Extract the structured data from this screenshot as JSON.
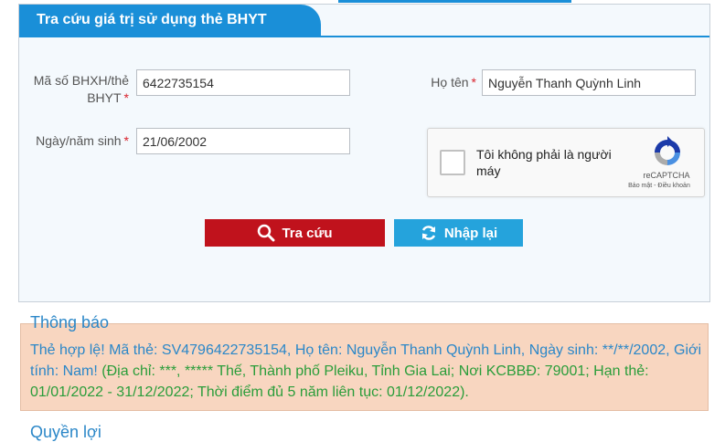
{
  "panel": {
    "title": "Tra cứu giá trị sử dụng thẻ BHYT"
  },
  "form": {
    "bhxh_label": "Mã số BHXH/thẻ BHYT",
    "bhxh_value": "6422735154",
    "name_label": "Họ tên",
    "name_value": "Nguyễn Thanh Quỳnh Linh",
    "dob_label": "Ngày/năm sinh",
    "dob_value": "21/06/2002",
    "required_mark": "*"
  },
  "captcha": {
    "label": "Tôi không phải là người máy",
    "brand": "reCAPTCHA",
    "links": "Bảo mật - Điều khoản"
  },
  "buttons": {
    "search": "Tra cứu",
    "reset": "Nhập lại"
  },
  "notice": {
    "title": "Thông báo",
    "line_blue": "Thẻ hợp lệ! Mã thẻ: SV4796422735154, Họ tên: Nguyễn Thanh Quỳnh Linh, Ngày sinh: **/**/2002, Giới tính: Nam! ",
    "line_green": "(Địa chỉ: ***, ***** Thế, Thành phố Pleiku, Tỉnh Gia Lai; Nơi KCBBĐ: 79001; Hạn thẻ: 01/01/2022 - 31/12/2022; Thời điểm đủ 5 năm liên tục: 01/12/2022)."
  },
  "section2": {
    "title": "Quyền lợi"
  },
  "colors": {
    "primary": "#1a8fd8",
    "danger": "#c0121c",
    "info": "#25a3dc",
    "notice_bg": "#f8d6c0"
  },
  "icons": {
    "search": "search-icon",
    "reset": "refresh-icon",
    "captcha": "recaptcha-logo-icon"
  }
}
